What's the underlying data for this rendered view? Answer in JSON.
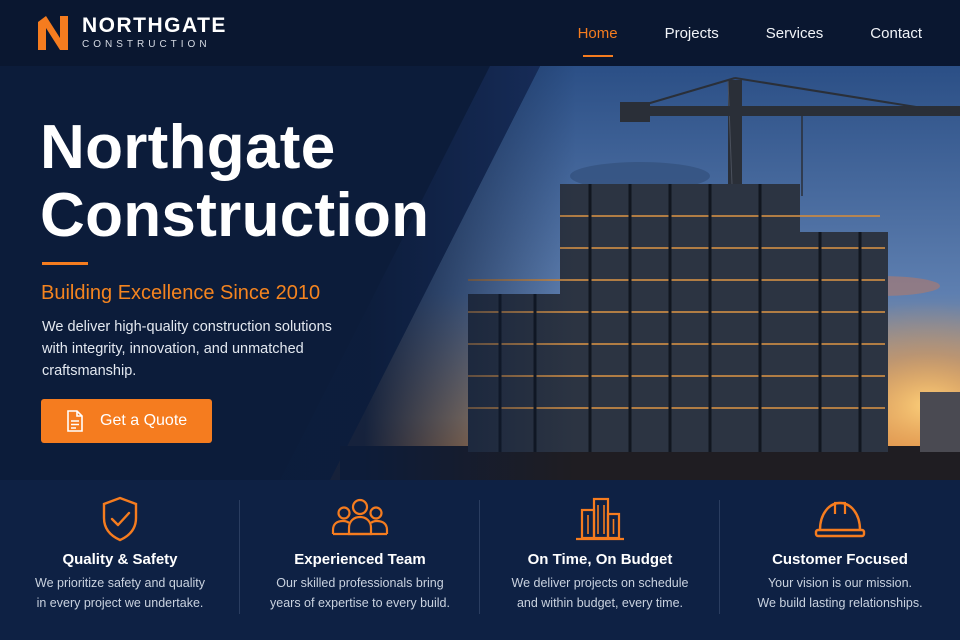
{
  "brand": {
    "name": "NORTHGATE",
    "tagline": "CONSTRUCTION",
    "accent": "#f57c1f"
  },
  "nav": {
    "items": [
      {
        "label": "Home",
        "active": true
      },
      {
        "label": "Projects",
        "active": false
      },
      {
        "label": "Services",
        "active": false
      },
      {
        "label": "Contact",
        "active": false
      }
    ]
  },
  "hero": {
    "title_line1": "Northgate",
    "title_line2": "Construction",
    "subtitle": "Building Excellence Since 2010",
    "description": "We deliver high-quality construction solutions with integrity, innovation, and unmatched craftsmanship.",
    "cta_label": "Get a Quote",
    "cta_icon": "document-icon",
    "image": "construction-site-with-crane"
  },
  "features": [
    {
      "icon": "shield-check-icon",
      "title": "Quality & Safety",
      "line1": "We prioritize safety and quality",
      "line2": "in every project we undertake."
    },
    {
      "icon": "team-icon",
      "title": "Experienced Team",
      "line1": "Our skilled professionals bring",
      "line2": "years of expertise to every build."
    },
    {
      "icon": "buildings-icon",
      "title": "On Time, On Budget",
      "line1": "We deliver projects on schedule",
      "line2": "and within budget, every time."
    },
    {
      "icon": "hard-hat-icon",
      "title": "Customer Focused",
      "line1": "Your vision is our mission.",
      "line2": "We build lasting relationships."
    }
  ]
}
